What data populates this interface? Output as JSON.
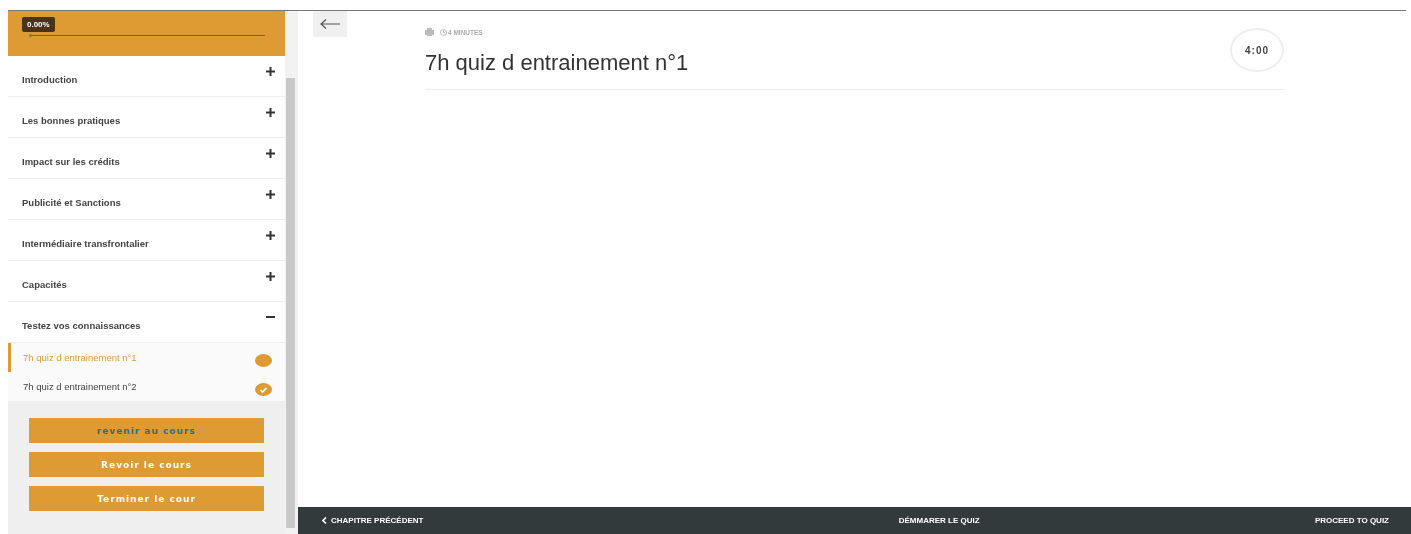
{
  "progress": {
    "label": "0.00%",
    "level": 0
  },
  "sections": [
    {
      "title": "Introduction",
      "expanded": false
    },
    {
      "title": "Les bonnes pratiques",
      "expanded": false
    },
    {
      "title": "Impact sur les crédits",
      "expanded": false
    },
    {
      "title": "Publicité et Sanctions",
      "expanded": false
    },
    {
      "title": "Intermédiaire transfrontalier",
      "expanded": false
    },
    {
      "title": "Capacités",
      "expanded": false
    },
    {
      "title": "Testez vos connaissances",
      "expanded": true,
      "lessons": [
        {
          "title": "7h quiz d entrainement n°1",
          "selected": true,
          "completed": false
        },
        {
          "title": "7h quiz d entrainement n°2",
          "selected": false,
          "completed": true
        }
      ]
    }
  ],
  "sidebar_buttons": [
    {
      "label": "revenir au cours",
      "kind": "link"
    },
    {
      "label": "Revoir le cours",
      "kind": "plain"
    },
    {
      "label": "Terminer le cour",
      "kind": "plain"
    }
  ],
  "lesson": {
    "duration": "4 MINUTES",
    "title": "7h quiz d entrainement n°1",
    "timer": "4:00"
  },
  "footer": {
    "previous": "CHAPITRE PRÉCÉDENT",
    "start": "DÉMMARER LE QUIZ",
    "proceed": "PROCEED TO QUIZ"
  }
}
